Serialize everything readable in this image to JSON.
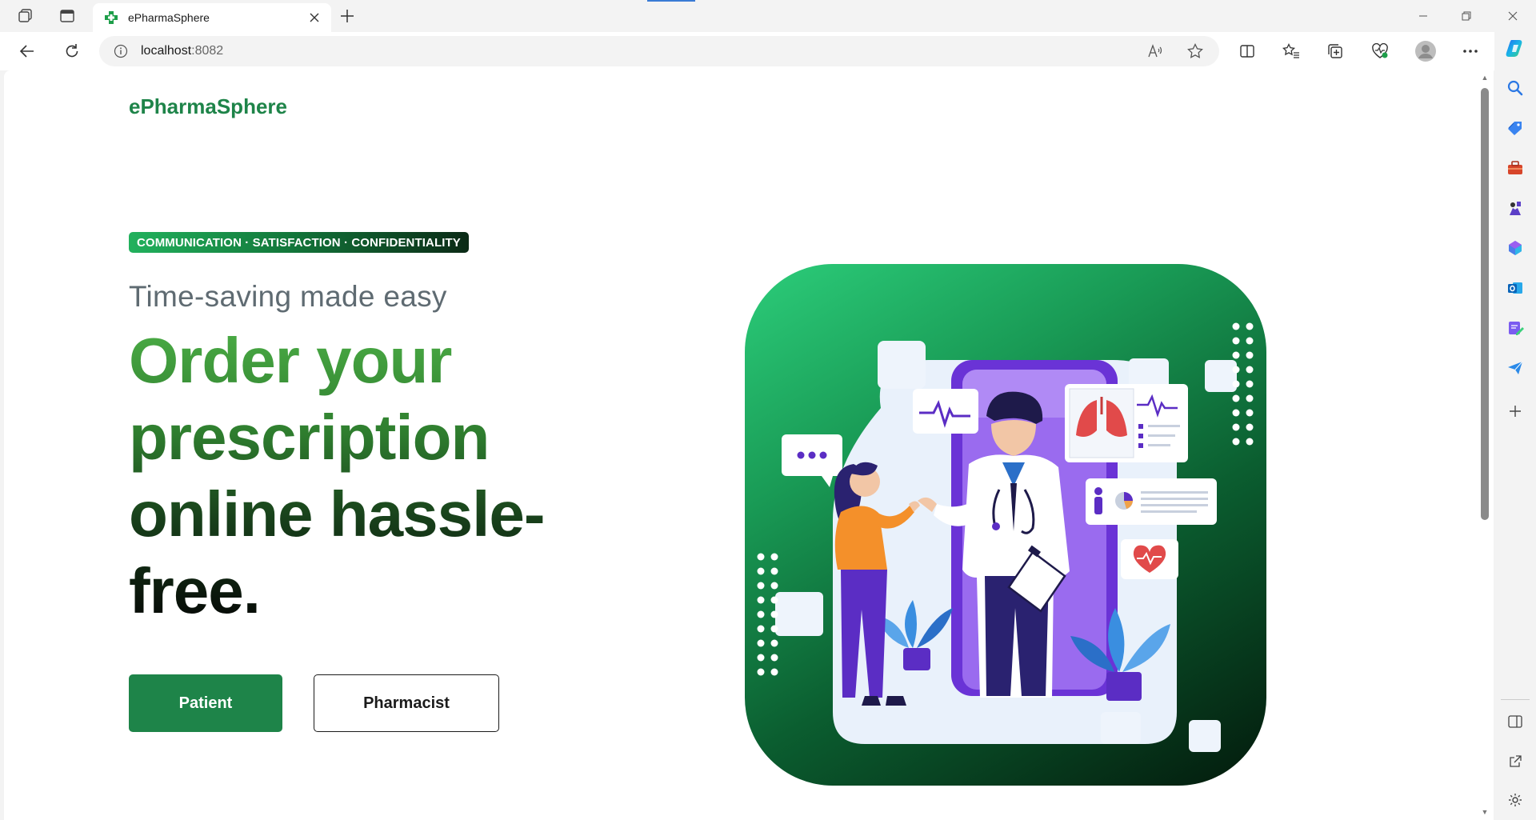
{
  "browser": {
    "tab": {
      "title": "ePharmaSphere"
    },
    "address": {
      "host": "localhost",
      "port": ":8082"
    }
  },
  "page": {
    "brand": "ePharmaSphere",
    "badge": "COMMUNICATION · SATISFACTION · CONFIDENTIALITY",
    "subtitle": "Time-saving made easy",
    "headline_lines": [
      "Order your",
      "prescription",
      "online hassle-",
      "free."
    ],
    "buttons": {
      "patient": "Patient",
      "pharmacist": "Pharmacist"
    }
  },
  "colors": {
    "brand_green": "#1e8449",
    "badge_start": "#22b15d",
    "badge_end": "#0b2a16",
    "hero_start": "#2ccd7a",
    "hero_end": "#031a0c"
  },
  "icons": [
    "workspaces-icon",
    "tab-actions-icon",
    "back-icon",
    "reload-icon",
    "info-icon",
    "read-aloud-icon",
    "favorite-star-icon",
    "split-screen-icon",
    "favorites-icon",
    "collections-icon",
    "browser-essentials-icon",
    "profile-avatar-icon",
    "more-icon",
    "copilot-icon",
    "search-icon",
    "shopping-tag-icon",
    "tools-icon",
    "games-icon",
    "microsoft-365-icon",
    "outlook-icon",
    "designer-icon",
    "send-icon",
    "add-icon",
    "sidebar-toggle-icon",
    "open-external-icon",
    "settings-icon"
  ]
}
